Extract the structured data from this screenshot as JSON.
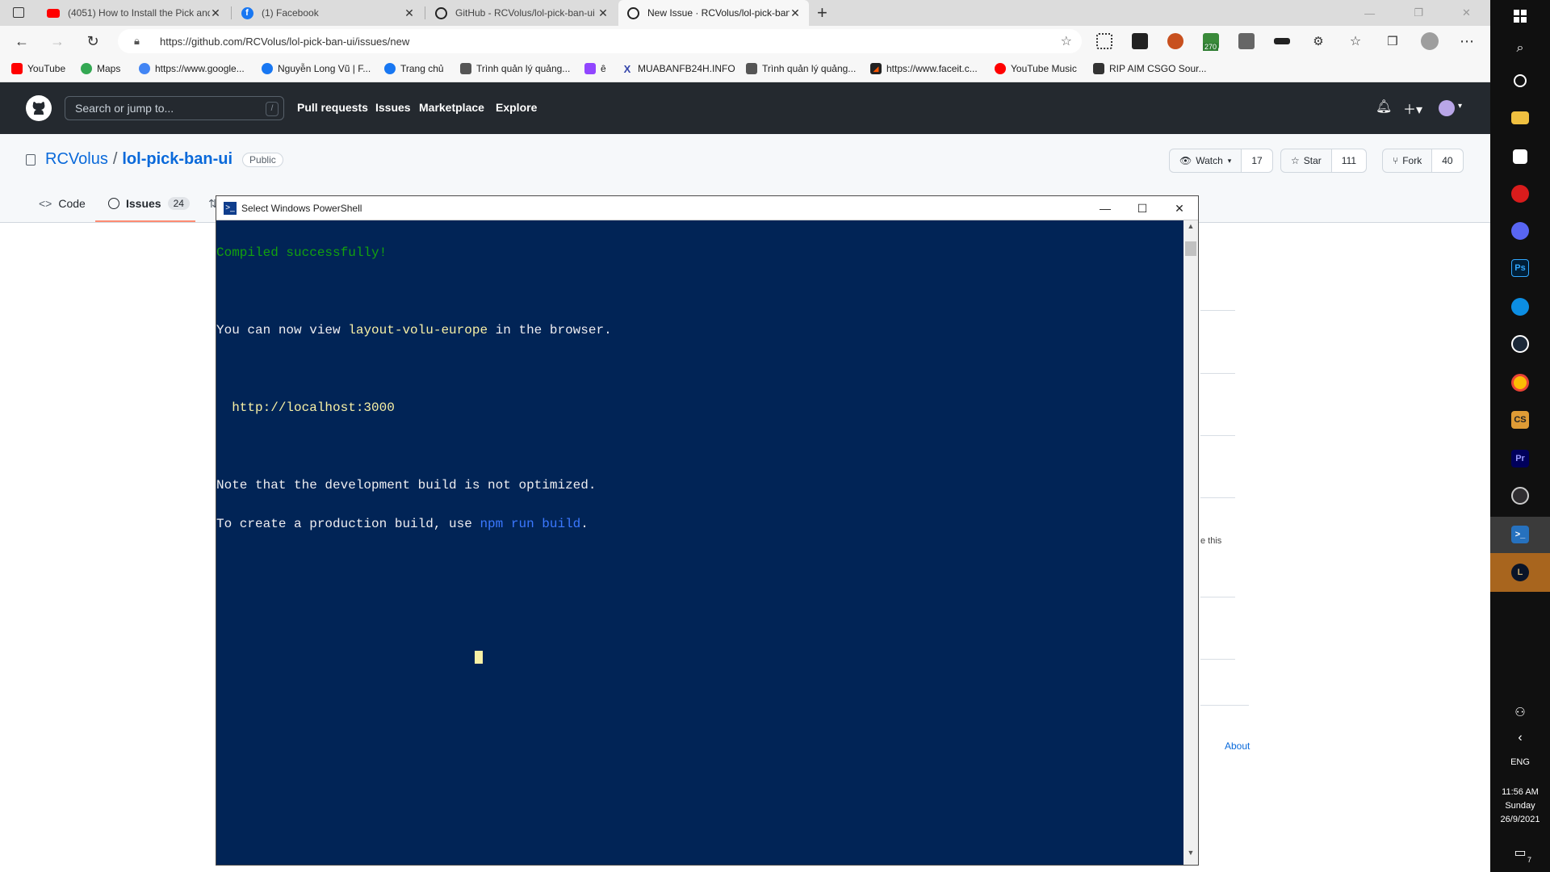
{
  "browser": {
    "tabs": [
      {
        "title": "(4051) How to Install the Pick and",
        "icon": "youtube-icon"
      },
      {
        "title": "(1) Facebook",
        "icon": "facebook-icon"
      },
      {
        "title": "GitHub - RCVolus/lol-pick-ban-ui",
        "icon": "github-icon"
      },
      {
        "title": "New Issue · RCVolus/lol-pick-ban-ui",
        "icon": "github-icon",
        "active": true
      }
    ],
    "new_tab": "+",
    "url": "https://github.com/RCVolus/lol-pick-ban-ui/issues/new",
    "extension_badge": "270",
    "bookmarks": [
      {
        "label": "YouTube",
        "icon": "youtube-icon",
        "color": "#ff0000"
      },
      {
        "label": "Maps",
        "icon": "maps-icon",
        "color": "#34a853"
      },
      {
        "label": "https://www.google...",
        "icon": "google-icon",
        "color": "#4285f4"
      },
      {
        "label": "Nguyễn Long Vũ | F...",
        "icon": "facebook-icon",
        "color": "#1877f2"
      },
      {
        "label": "Trang chủ",
        "icon": "facebook-icon",
        "color": "#1877f2"
      },
      {
        "label": "Trình quản lý quảng...",
        "icon": "ads-manager-icon",
        "color": "#555555"
      },
      {
        "label": "ê",
        "icon": "twitch-icon",
        "color": "#9146ff"
      },
      {
        "label": "MUABANFB24H.INFO",
        "icon": "x-icon",
        "color": "#3344aa"
      },
      {
        "label": "Trình quản lý quảng...",
        "icon": "ads-manager-icon",
        "color": "#555555"
      },
      {
        "label": "https://www.faceit.c...",
        "icon": "faceit-icon",
        "color": "#ff5500"
      },
      {
        "label": "YouTube Music",
        "icon": "youtube-music-icon",
        "color": "#ff0000"
      },
      {
        "label": "RIP AIM CSGO Sour...",
        "icon": "csgo-icon",
        "color": "#333333"
      }
    ]
  },
  "github": {
    "search_placeholder": "Search or jump to...",
    "search_shortcut": "/",
    "nav": [
      "Pull requests",
      "Issues",
      "Marketplace",
      "Explore"
    ],
    "owner": "RCVolus",
    "separator": "/",
    "repo": "lol-pick-ban-ui",
    "visibility": "Public",
    "watch_label": "Watch",
    "watch_count": "17",
    "star_label": "Star",
    "star_count": "111",
    "fork_label": "Fork",
    "fork_count": "40",
    "tabs": {
      "code": "Code",
      "issues": "Issues",
      "issues_count": "24"
    },
    "partial_hint": "e this",
    "about_link": "About"
  },
  "powershell": {
    "title": "Select Windows PowerShell",
    "lines": {
      "compiled": "Compiled successfully!",
      "view_prefix": "You can now view ",
      "app_name": "layout-volu-europe",
      "view_suffix": " in the browser.",
      "url_indent": "  ",
      "url": "http://localhost:3000",
      "note": "Note that the development build is not optimized.",
      "build_prefix": "To create a production build, use ",
      "build_cmd": "npm run build",
      "build_suffix": "."
    },
    "colors": {
      "background": "#012456",
      "success": "#13a10e",
      "highlight": "#f9f1a5",
      "command": "#3b78ff"
    }
  },
  "taskbar": {
    "language": "ENG",
    "time": "11:56 AM",
    "day": "Sunday",
    "date": "26/9/2021",
    "notification_count": "7"
  }
}
